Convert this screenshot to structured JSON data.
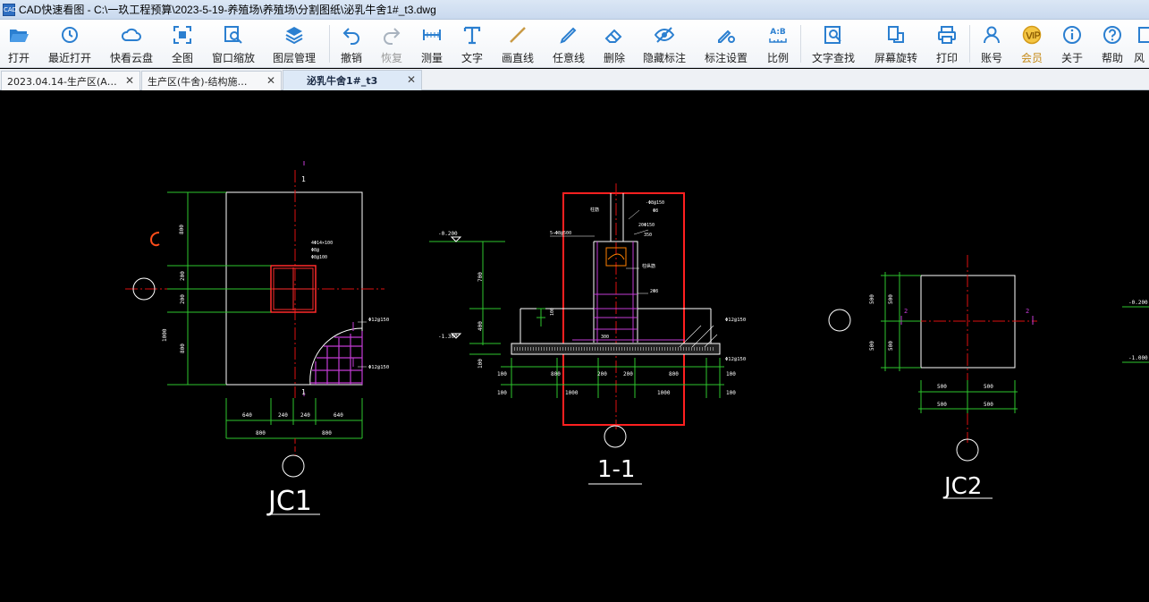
{
  "window": {
    "title": "CAD快速看图 - C:\\一玖工程预算\\2023-5-19-养殖场\\养殖场\\分割图纸\\泌乳牛舍1#_t3.dwg",
    "app_icon_text": "CAD"
  },
  "toolbar": {
    "open": "打开",
    "recent": "最近打开",
    "cloud": "快看云盘",
    "fit": "全图",
    "zoom_window": "窗口缩放",
    "layers": "图层管理",
    "undo": "撤销",
    "redo": "恢复",
    "measure": "测量",
    "text": "文字",
    "line": "画直线",
    "freehand": "任意线",
    "erase": "删除",
    "hide_marks": "隐藏标注",
    "mark_settings": "标注设置",
    "scale": "比例",
    "text_search": "文字查找",
    "rotate": "屏幕旋转",
    "print": "打印",
    "account": "账号",
    "member": "会员",
    "about": "关于",
    "help": "帮助",
    "more": "风",
    "scale_icon_text": "A:B"
  },
  "tabs": [
    {
      "label": "2023.04.14-生产区(A…"
    },
    {
      "label": "生产区(牛舍)-结构施…"
    },
    {
      "label": "泌乳牛舍1#_t3"
    }
  ],
  "drawing": {
    "labels": {
      "jc1": "JC1",
      "section": "1-1",
      "jc2": "JC2"
    },
    "section_marks": {
      "cut1_top": "1",
      "cut1_bottom": "1",
      "cut2_left": "2",
      "cut2_right": "2"
    },
    "jc1_dims": {
      "v_top": "800",
      "v_mid1": "200",
      "v_mid2": "200",
      "v_bottom": "800",
      "v_total": "1000",
      "h_a": "640",
      "h_b": "240",
      "h_c": "240",
      "h_d": "640",
      "h_left": "800",
      "h_right": "800"
    },
    "jc1_notes": [
      "4Φ14×100",
      "Φ8@",
      "Φ8@100"
    ],
    "rebar_notes": [
      "Φ12@150",
      "Φ12@150"
    ],
    "section_elevations": {
      "top": "-0.200",
      "bottom": "-1.300"
    },
    "section_dims": {
      "v_700": "700",
      "v_400": "400",
      "v_100": "100",
      "v_100b": "100",
      "b_100a": "100",
      "b_800a": "800",
      "b_200a": "200",
      "b_200b": "200",
      "b_800b": "800",
      "b_100b": "100",
      "c_100a": "100",
      "c_1000a": "1000",
      "c_1000b": "1000",
      "c_100b": "100",
      "h_300": "300"
    },
    "section_notes": {
      "col_label": "柱筋",
      "ties": "-Φ8@150",
      "note1": "Φ8",
      "stirrups": "20Φ150",
      "val350": "350",
      "bars": "5→Φ8@500",
      "col_ties": "柱纵筋",
      "sq": "2Φ8",
      "rebar_right1": "Φ12@150",
      "rebar_right2": "Φ12@150"
    },
    "jc2_dims": {
      "v1": "500",
      "v2": "500",
      "v3": "500",
      "v4": "500",
      "h1": "500",
      "h2": "500",
      "h3": "500",
      "h4": "500"
    },
    "right_edge": {
      "top": "-0.200",
      "bottom": "-1.000"
    }
  }
}
